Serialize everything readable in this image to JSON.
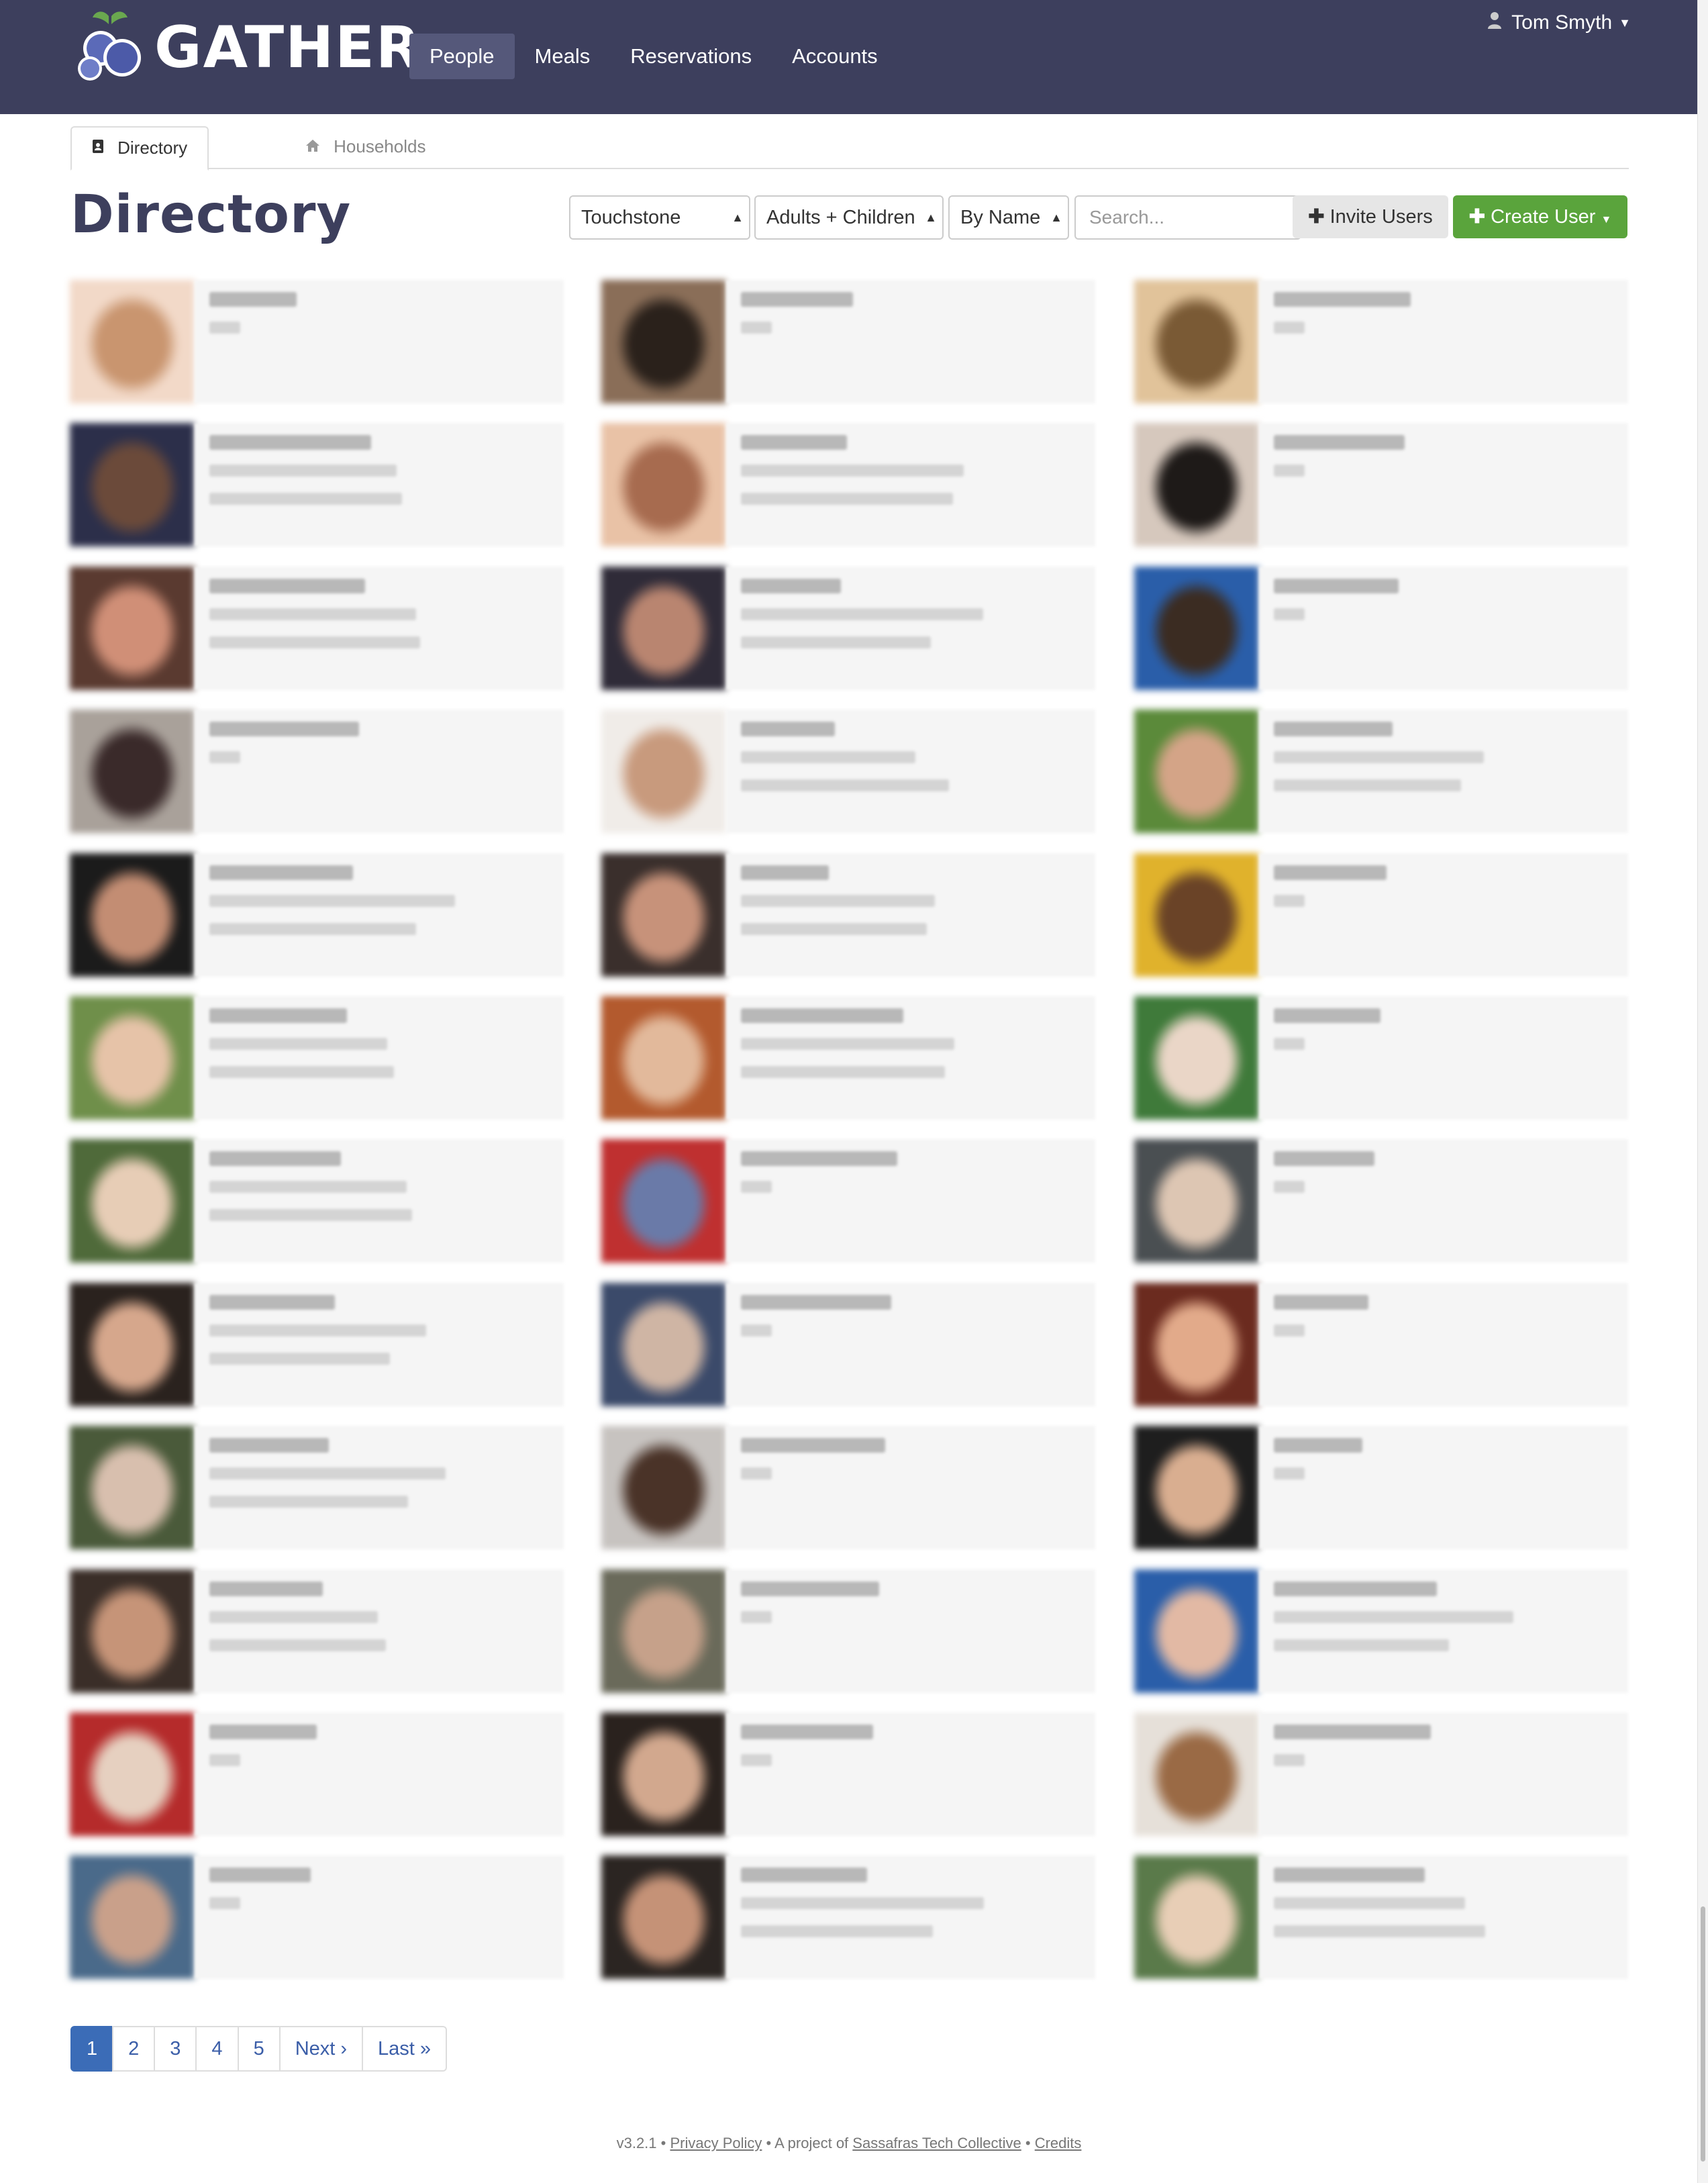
{
  "app": {
    "brand": "GATHER"
  },
  "nav": {
    "links": [
      {
        "label": "People",
        "active": true
      },
      {
        "label": "Meals",
        "active": false
      },
      {
        "label": "Reservations",
        "active": false
      },
      {
        "label": "Accounts",
        "active": false
      }
    ],
    "user_name": "Tom Smyth"
  },
  "tabs": {
    "directory": "Directory",
    "households": "Households"
  },
  "page": {
    "title": "Directory"
  },
  "toolbar": {
    "community_select": "Touchstone",
    "age_select": "Adults + Children",
    "sort_select": "By Name",
    "search_placeholder": "Search...",
    "invite_label": "Invite Users",
    "create_label": "Create User"
  },
  "colors": {
    "navbar": "#3d3f5d",
    "nav_active": "#55587a",
    "title": "#3d3f5d",
    "create_button": "#5aa43c",
    "invite_button": "#e6e6e6",
    "page_active": "#3b6cb7",
    "link": "#3b5ea8"
  },
  "icons": {
    "logo": "blueberry-logo-icon",
    "user": "user-icon",
    "directory_tab": "address-book-icon",
    "households_tab": "home-icon",
    "invite": "plus-icon",
    "create": "plus-icon"
  },
  "cards": [
    {
      "photo": [
        "#f2d9c8",
        "#c9956f"
      ],
      "lines": 1
    },
    {
      "photo": [
        "#8a6e58",
        "#2a211b"
      ],
      "lines": 1
    },
    {
      "photo": [
        "#e1c39a",
        "#7a5a35"
      ],
      "lines": 1
    },
    {
      "photo": [
        "#2c2f4a",
        "#6b4a3a"
      ],
      "lines": 2
    },
    {
      "photo": [
        "#e9c2a6",
        "#a76b4f"
      ],
      "lines": 2
    },
    {
      "photo": [
        "#d6c8bd",
        "#1e1a18"
      ],
      "lines": 1
    },
    {
      "photo": [
        "#5a3a30",
        "#d08f77"
      ],
      "lines": 2
    },
    {
      "photo": [
        "#2f2b38",
        "#b98570"
      ],
      "lines": 2
    },
    {
      "photo": [
        "#2a5ea9",
        "#3b2c22"
      ],
      "lines": 1
    },
    {
      "photo": [
        "#a9a19a",
        "#3a2a2a"
      ],
      "lines": 1
    },
    {
      "photo": [
        "#f0ece8",
        "#c89a7d"
      ],
      "lines": 2
    },
    {
      "photo": [
        "#5b8a3a",
        "#d4a487"
      ],
      "lines": 2
    },
    {
      "photo": [
        "#1b1b1b",
        "#c38d73"
      ],
      "lines": 2
    },
    {
      "photo": [
        "#3a2f2c",
        "#c7927a"
      ],
      "lines": 2
    },
    {
      "photo": [
        "#e0b22c",
        "#6a4327"
      ],
      "lines": 1
    },
    {
      "photo": [
        "#6f8f4a",
        "#e6c3a8"
      ],
      "lines": 2
    },
    {
      "photo": [
        "#b35a2e",
        "#e2b99b"
      ],
      "lines": 2
    },
    {
      "photo": [
        "#3f7a3a",
        "#ead6c7"
      ],
      "lines": 1
    },
    {
      "photo": [
        "#4f6a3a",
        "#e7cdb6"
      ],
      "lines": 2
    },
    {
      "photo": [
        "#bf3030",
        "#6a7aa8"
      ],
      "lines": 1
    },
    {
      "photo": [
        "#4a4f52",
        "#ddc6b3"
      ],
      "lines": 1
    },
    {
      "photo": [
        "#2a221e",
        "#d6a78c"
      ],
      "lines": 2
    },
    {
      "photo": [
        "#3b4a6a",
        "#cfb5a4"
      ],
      "lines": 1
    },
    {
      "photo": [
        "#6b2b1f",
        "#e2aa8a"
      ],
      "lines": 1
    },
    {
      "photo": [
        "#4a5a3a",
        "#d8bfae"
      ],
      "lines": 2
    },
    {
      "photo": [
        "#c7c3c0",
        "#4a3328"
      ],
      "lines": 1
    },
    {
      "photo": [
        "#1e1e1e",
        "#d9ae90"
      ],
      "lines": 1
    },
    {
      "photo": [
        "#3a2e28",
        "#c69478"
      ],
      "lines": 2
    },
    {
      "photo": [
        "#6a6a5a",
        "#c6a18a"
      ],
      "lines": 1
    },
    {
      "photo": [
        "#2a5ea9",
        "#e2b9a4"
      ],
      "lines": 2
    },
    {
      "photo": [
        "#b52b2b",
        "#e6d0c0"
      ],
      "lines": 1
    },
    {
      "photo": [
        "#2a221e",
        "#d2a88e"
      ],
      "lines": 1
    },
    {
      "photo": [
        "#e6e0d9",
        "#9a6a45"
      ],
      "lines": 1
    },
    {
      "photo": [
        "#4a6a8a",
        "#c9a08a"
      ],
      "lines": 1
    },
    {
      "photo": [
        "#2b2522",
        "#c59277"
      ],
      "lines": 2
    },
    {
      "photo": [
        "#5a7a4a",
        "#e8ceb6"
      ],
      "lines": 2
    }
  ],
  "pagination": {
    "pages": [
      {
        "label": "1",
        "active": true
      },
      {
        "label": "2",
        "active": false
      },
      {
        "label": "3",
        "active": false
      },
      {
        "label": "4",
        "active": false
      },
      {
        "label": "5",
        "active": false
      },
      {
        "label": "Next ›",
        "active": false
      },
      {
        "label": "Last »",
        "active": false
      }
    ]
  },
  "footer": {
    "version": "v3.2.1",
    "sep1": " • ",
    "privacy_link": "Privacy Policy",
    "project_text": " • A project of ",
    "sassafras_link": "Sassafras Tech Collective",
    "sep2": " • ",
    "credits_link": "Credits"
  }
}
